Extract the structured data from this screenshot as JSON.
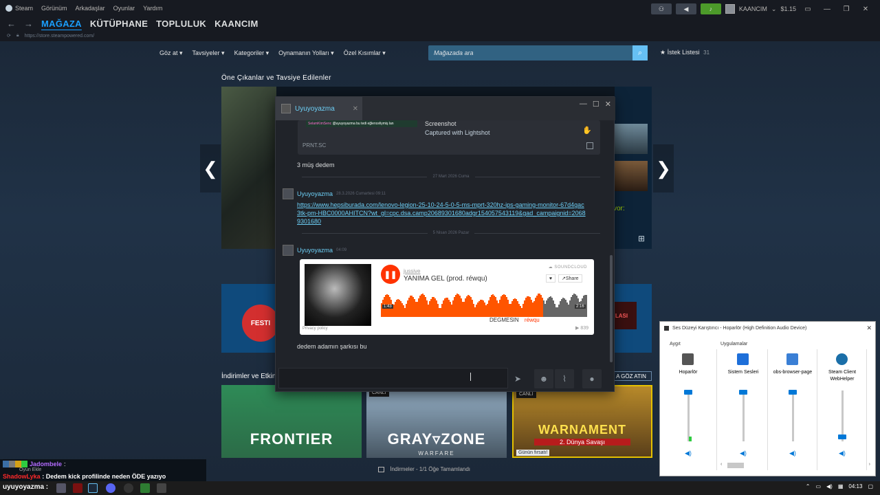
{
  "steam": {
    "app_name": "Steam",
    "menu": [
      "Görünüm",
      "Arkadaşlar",
      "Oyunlar",
      "Yardım"
    ],
    "account": "KAANCIM",
    "balance": "$1.15",
    "nav": [
      "MAĞAZA",
      "KÜTÜPHANE",
      "TOPLULUK",
      "KAANCIM"
    ],
    "url": "https://store.steampowered.com/"
  },
  "store": {
    "nav": [
      "Göz at ▾",
      "Tavsiyeler ▾",
      "Kategoriler ▾",
      "Oynamanın Yolları ▾",
      "Özel Kısımlar ▾"
    ],
    "search_placeholder": "Mağazada ara",
    "wishlist_label": "İstek Listesi",
    "wishlist_count": "31",
    "featured_title": "Öne Çıkanlar ve Tavsiye Edilenler",
    "featured_side_text": "vor:",
    "promo_left": "FESTI",
    "promo_right": "LASI",
    "deals_title": "İndirimler ve Etkin",
    "see_all": "A GÖZ ATIN",
    "cards": [
      {
        "name": "FRONTIER",
        "sub": "",
        "badge": ""
      },
      {
        "name": "GRAY▿ZONE",
        "sub": "WARFARE",
        "badge": "CANLI"
      },
      {
        "name": "WARNAMENT",
        "sub": "2. Dünya Savaşı",
        "badge": "CANLI",
        "extra": "Günün fırsatı!"
      }
    ],
    "downloads": "İndirmeler - 1/1 Öğe Tamamlandı"
  },
  "chat": {
    "tab_name": "Uyuyoyazma",
    "embed_screenshot": {
      "snap_user": "SelamKimSenc",
      "snap_text": "@uyuyoyazma bu tedi eğlenceliymiş lan",
      "title": "Screenshot",
      "desc": "Captured with Lightshot",
      "source": "PRNT.SC"
    },
    "msg1": "3 müş dedem",
    "sep1": "27 Mart 2026 Cuma",
    "msg2_name": "Uyuyoyazma",
    "msg2_time": "28.3.2026 Cumartesi 09:11",
    "msg2_link": "https://www.hepsiburada.com/lenovo-legion-25-10-24-5-0-5-ms-mprt-320hz-ips-gaming-monitor-67d4gac3tk-pm-HBC0000AHITCN?wt_gl=cpc.dsa.camp20689301680adgr154057543119&gad_campaignid=20689301680",
    "sep2": "5 Nisan 2026 Pazar",
    "msg3_name": "Uyuyoyazma",
    "msg3_time": "04:09",
    "soundcloud": {
      "artist": "jussive",
      "title": "YANIMA GEL (prod. réwqu)",
      "logo": "SOUNDCLOUD",
      "share": "Share",
      "time_left": "1:43",
      "time_right": "2:16",
      "comment": "DEGMESIN",
      "comment_user": "réwqu",
      "privacy": "Privacy policy",
      "plays": "▶ 839"
    },
    "msg4": "dedem adamın şarkısı bu"
  },
  "mixer": {
    "title": "Ses Düzeyi Karıştırıcı - Hoparlör (High Definition Audio Device)",
    "device_header": "Aygıt",
    "apps_header": "Uygulamalar",
    "channels": [
      {
        "name": "Hoparlör",
        "level": 0.97,
        "peak": 0.1
      },
      {
        "name": "Sistem Sesleri",
        "level": 0.97,
        "peak": 0
      },
      {
        "name": "obs-browser-page",
        "level": 0.97,
        "peak": 0
      },
      {
        "name": "Steam Client WebHelper",
        "level": 0.1,
        "peak": 0
      }
    ]
  },
  "overlay": {
    "user1": "Jadombele",
    "user1_sub": "Oyun Ekle",
    "user2": "ShadowLyka",
    "msg2": ": Dedem kick profilinde neden ÖDE yazıyo"
  },
  "taskbar": {
    "user": "uyuyoyazma :",
    "clock": "04:13"
  }
}
